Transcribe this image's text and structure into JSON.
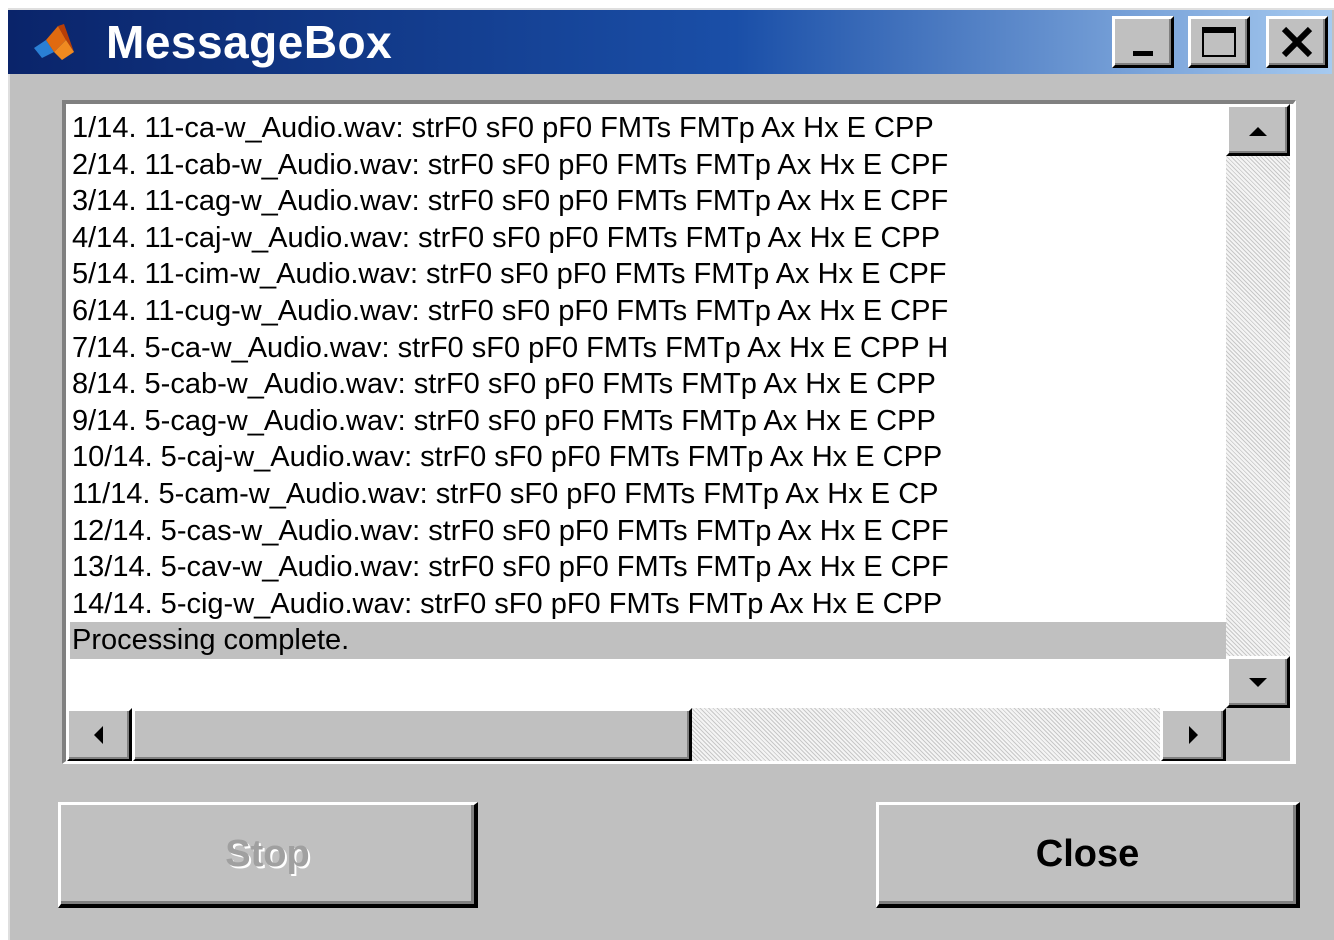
{
  "window": {
    "title": "MessageBox",
    "icon": "matlab-logo-icon",
    "controls": [
      "minimize-icon",
      "maximize-icon",
      "close-icon"
    ]
  },
  "log": {
    "lines": [
      "1/14. 11-ca-w_Audio.wav: strF0 sF0 pF0 FMTs FMTp Ax Hx E CPP",
      "2/14. 11-cab-w_Audio.wav: strF0 sF0 pF0 FMTs FMTp Ax Hx E CPF",
      "3/14. 11-cag-w_Audio.wav: strF0 sF0 pF0 FMTs FMTp Ax Hx E CPF",
      "4/14. 11-caj-w_Audio.wav: strF0 sF0 pF0 FMTs FMTp Ax Hx E CPP",
      "5/14. 11-cim-w_Audio.wav: strF0 sF0 pF0 FMTs FMTp Ax Hx E CPF",
      "6/14. 11-cug-w_Audio.wav: strF0 sF0 pF0 FMTs FMTp Ax Hx E CPF",
      "7/14. 5-ca-w_Audio.wav: strF0 sF0 pF0 FMTs FMTp Ax Hx E CPP H",
      "8/14. 5-cab-w_Audio.wav: strF0 sF0 pF0 FMTs FMTp Ax Hx E CPP",
      "9/14. 5-cag-w_Audio.wav: strF0 sF0 pF0 FMTs FMTp Ax Hx E CPP",
      "10/14. 5-caj-w_Audio.wav: strF0 sF0 pF0 FMTs FMTp Ax Hx E CPP",
      "11/14. 5-cam-w_Audio.wav: strF0 sF0 pF0 FMTs FMTp Ax Hx E CP",
      "12/14. 5-cas-w_Audio.wav: strF0 sF0 pF0 FMTs FMTp Ax Hx E CPF",
      "13/14. 5-cav-w_Audio.wav: strF0 sF0 pF0 FMTs FMTp Ax Hx E CPF",
      "14/14. 5-cig-w_Audio.wav: strF0 sF0 pF0 FMTs FMTp Ax Hx E CPP",
      "Processing complete."
    ],
    "selected_index": 14
  },
  "buttons": {
    "stop_label": "Stop",
    "close_label": "Close"
  },
  "colors": {
    "titlebar_start": "#0a246a",
    "titlebar_end": "#a6caf0",
    "face": "#c0c0c0",
    "disabled_text": "#a0a0a0"
  }
}
